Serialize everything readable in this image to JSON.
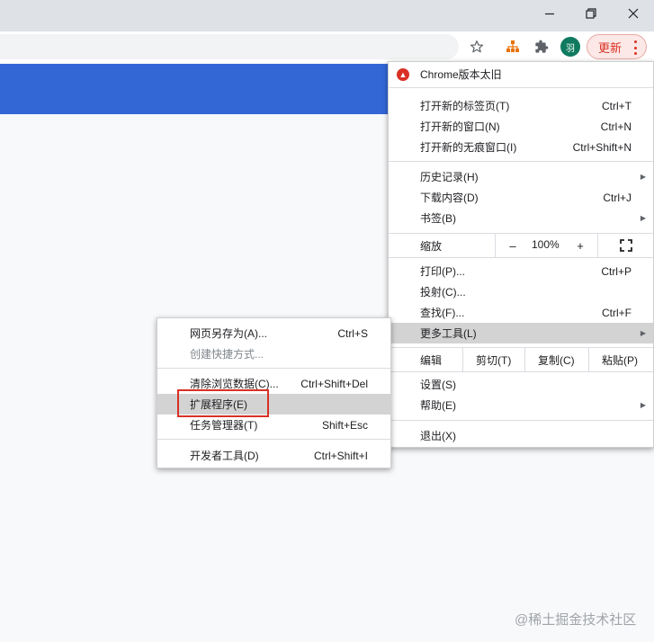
{
  "window": {
    "minimize_icon": "minimize-icon",
    "maximize_icon": "restore-icon",
    "close_icon": "close-icon"
  },
  "toolbar": {
    "avatar_text": "羽",
    "update_button_label": "更新",
    "icons": [
      "bookmark-star-icon",
      "extension-icon",
      "puzzle-extensions-icon",
      "kebab-menu-icon"
    ]
  },
  "colors": {
    "accent_blue": "#3367d6",
    "update_red": "#d93025",
    "avatar_green": "#0f7a5f"
  },
  "main_menu": {
    "update_item": "Chrome版本太旧",
    "new_tab": {
      "label": "打开新的标签页(T)",
      "shortcut": "Ctrl+T"
    },
    "new_window": {
      "label": "打开新的窗口(N)",
      "shortcut": "Ctrl+N"
    },
    "incognito": {
      "label": "打开新的无痕窗口(I)",
      "shortcut": "Ctrl+Shift+N"
    },
    "history": {
      "label": "历史记录(H)"
    },
    "downloads": {
      "label": "下载内容(D)",
      "shortcut": "Ctrl+J"
    },
    "bookmarks": {
      "label": "书签(B)"
    },
    "zoom": {
      "label": "缩放",
      "minus": "–",
      "value": "100%",
      "plus": "+"
    },
    "print": {
      "label": "打印(P)...",
      "shortcut": "Ctrl+P"
    },
    "cast": {
      "label": "投射(C)..."
    },
    "find": {
      "label": "查找(F)...",
      "shortcut": "Ctrl+F"
    },
    "more_tools": {
      "label": "更多工具(L)"
    },
    "edit": {
      "label": "编辑",
      "cut": "剪切(T)",
      "copy": "复制(C)",
      "paste": "粘贴(P)"
    },
    "settings": {
      "label": "设置(S)"
    },
    "help": {
      "label": "帮助(E)"
    },
    "exit": {
      "label": "退出(X)"
    }
  },
  "sub_menu": {
    "save_page": {
      "label": "网页另存为(A)...",
      "shortcut": "Ctrl+S"
    },
    "create_shortcut": {
      "label": "创建快捷方式..."
    },
    "clear_data": {
      "label": "清除浏览数据(C)...",
      "shortcut": "Ctrl+Shift+Del"
    },
    "extensions": {
      "label": "扩展程序(E)"
    },
    "task_manager": {
      "label": "任务管理器(T)",
      "shortcut": "Shift+Esc"
    },
    "dev_tools": {
      "label": "开发者工具(D)",
      "shortcut": "Ctrl+Shift+I"
    }
  },
  "watermark": "@稀土掘金技术社区"
}
